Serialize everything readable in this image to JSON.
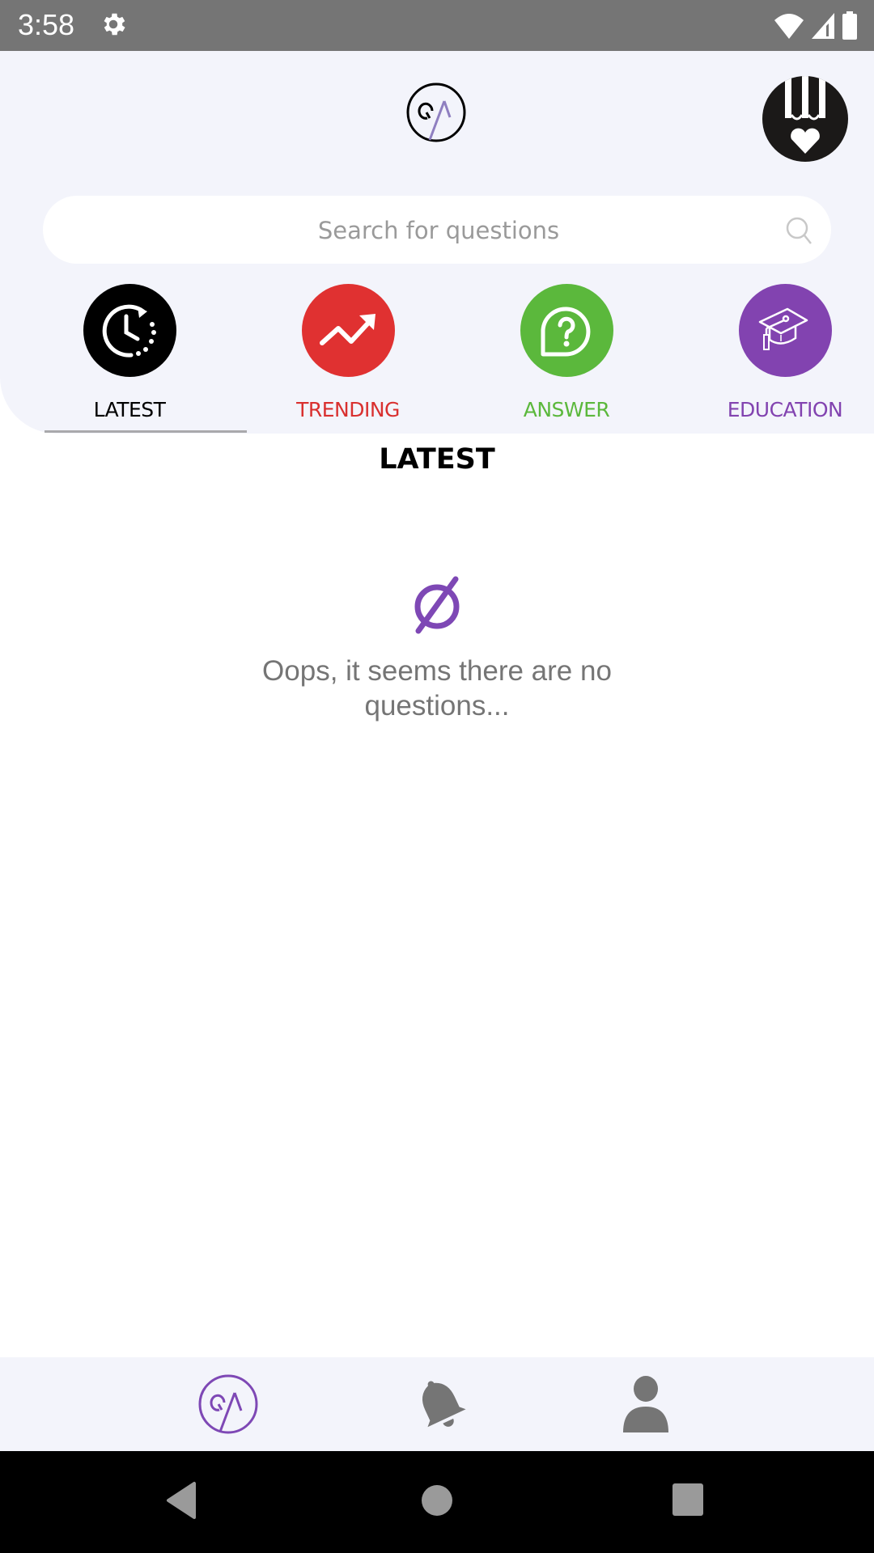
{
  "status_bar": {
    "time": "3:58",
    "icons": [
      "settings-icon",
      "wifi-icon",
      "cellular-signal-icon",
      "battery-icon"
    ]
  },
  "header": {
    "logo_icon": "qa-logo-icon",
    "avatar_icon": "pencil-heart-avatar-icon"
  },
  "search": {
    "placeholder": "Search for questions",
    "value": "",
    "icon": "search-icon"
  },
  "categories": [
    {
      "label": "LATEST",
      "icon": "clock-refresh-icon",
      "color": "#000000",
      "label_color": "#000000",
      "selected": true
    },
    {
      "label": "TRENDING",
      "icon": "trending-up-icon",
      "color": "#e03131",
      "label_color": "#d9302f",
      "selected": false
    },
    {
      "label": "ANSWER",
      "icon": "question-bubble-icon",
      "color": "#5bb83c",
      "label_color": "#5bb83c",
      "selected": false
    },
    {
      "label": "EDUCATION",
      "icon": "graduation-cap-icon",
      "color": "#8243b0",
      "label_color": "#8243b0",
      "selected": false
    }
  ],
  "main": {
    "section_title": "LATEST",
    "empty_icon": "empty-set-icon",
    "empty_message": "Oops, it seems there are no questions...",
    "accent_color": "#7e48b5"
  },
  "bottom_nav": {
    "items": [
      {
        "name": "home",
        "icon": "qa-logo-icon",
        "active": true
      },
      {
        "name": "notifications",
        "icon": "bell-icon",
        "active": false
      },
      {
        "name": "profile",
        "icon": "person-icon",
        "active": false
      }
    ]
  },
  "system_nav": {
    "items": [
      "back-icon",
      "home-icon",
      "recents-icon"
    ]
  }
}
